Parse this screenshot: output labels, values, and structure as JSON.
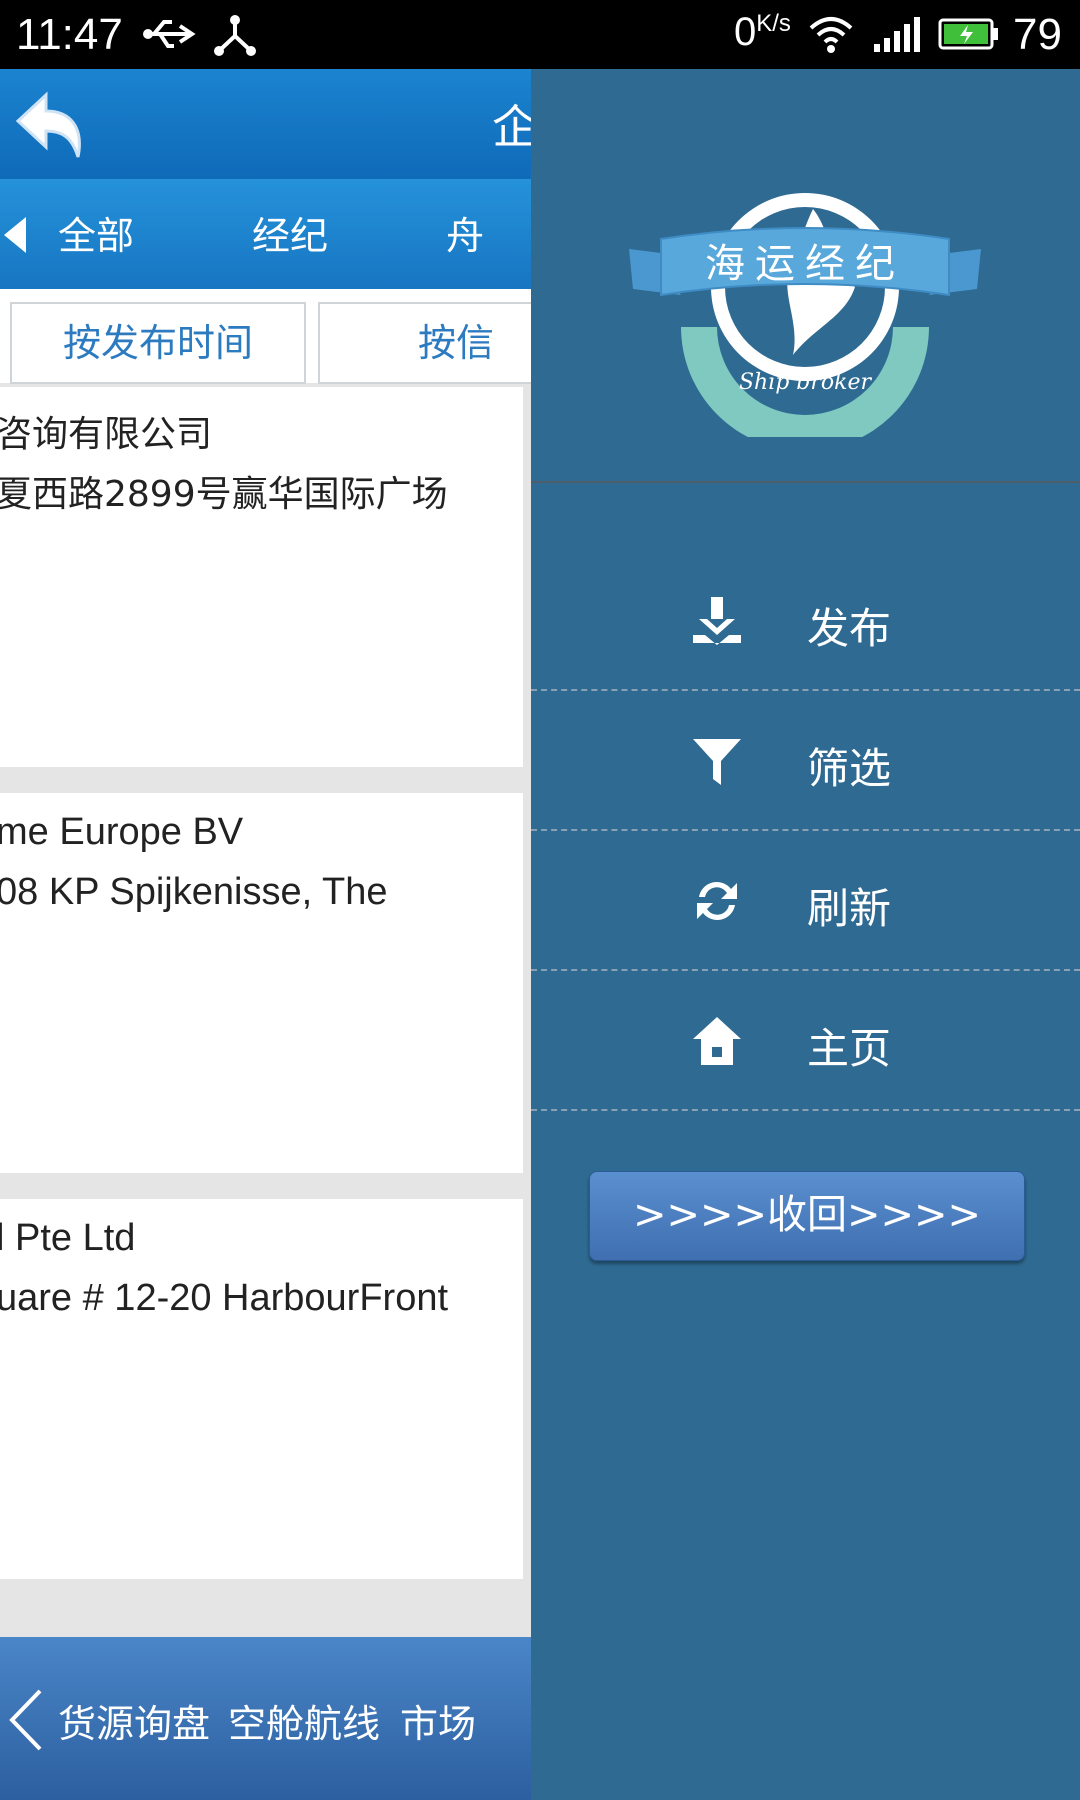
{
  "status_bar": {
    "time": "11:47",
    "net_speed": "0",
    "net_speed_unit": "K/s",
    "battery_percent": "79"
  },
  "app": {
    "title_partial": "企",
    "tabs": [
      "全部",
      "经纪",
      "舟"
    ],
    "sort_buttons": [
      "按发布时间",
      "按信"
    ],
    "cards": [
      {
        "line1": "咨询有限公司",
        "line2": "夏西路2899号赢华国际广场"
      },
      {
        "line1": "me Europe BV",
        "line2": "08 KP Spijkenisse, The"
      },
      {
        "line1": "l Pte Ltd",
        "line2": "uare # 12-20 HarbourFront"
      }
    ],
    "bottom_nav": [
      "货源询盘",
      "空舱航线",
      "市场"
    ]
  },
  "drawer": {
    "logo_text": "海运经纪",
    "logo_subtext": "Ship   broker",
    "menu": [
      {
        "label": "发布",
        "icon": "publish-icon"
      },
      {
        "label": "筛选",
        "icon": "filter-icon"
      },
      {
        "label": "刷新",
        "icon": "refresh-icon"
      },
      {
        "label": "主页",
        "icon": "home-icon"
      }
    ],
    "collapse_label": ">>>>收回>>>>"
  },
  "colors": {
    "drawer_bg": "#2e6a92",
    "header_blue": "#1b84d0",
    "bottom_nav_blue": "#3a72b8",
    "sort_text": "#2c7bc0"
  }
}
